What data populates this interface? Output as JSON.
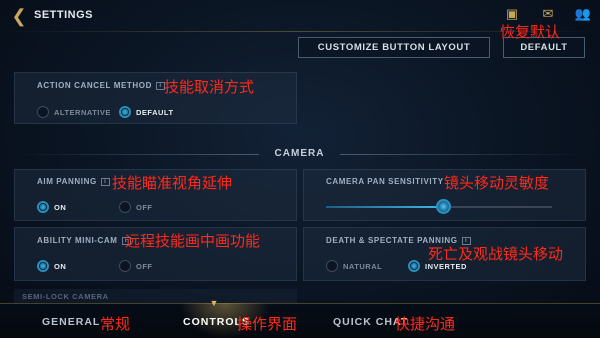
{
  "header": {
    "back_icon": "chevron-left-icon",
    "title": "SETTINGS",
    "icons": [
      "clipboard-check-icon",
      "chat-icon",
      "friends-icon"
    ]
  },
  "buttons": {
    "customize_layout": "CUSTOMIZE BUTTON LAYOUT",
    "default": "DEFAULT"
  },
  "general_settings": {
    "action_cancel_method": {
      "label": "ACTION CANCEL METHOD",
      "options": [
        "ALTERNATIVE",
        "DEFAULT"
      ],
      "selected": "DEFAULT"
    }
  },
  "camera": {
    "section_title": "CAMERA",
    "aim_panning": {
      "label": "AIM PANNING",
      "options": [
        "ON",
        "OFF"
      ],
      "selected": "ON"
    },
    "camera_pan_sensitivity": {
      "label": "CAMERA PAN SENSITIVITY",
      "value_fraction": 0.52
    },
    "ability_mini_cam": {
      "label": "ABILITY MINI-CAM",
      "options": [
        "ON",
        "OFF"
      ],
      "selected": "ON"
    },
    "death_spectate_panning": {
      "label": "DEATH & SPECTATE PANNING",
      "options": [
        "NATURAL",
        "INVERTED"
      ],
      "selected": "INVERTED"
    },
    "semi_lock_camera": {
      "label": "SEMI-LOCK CAMERA"
    }
  },
  "annotations": {
    "restore_default": "恢复默认",
    "action_cancel": "技能取消方式",
    "aim_panning": "技能瞄准视角延伸",
    "pan_sensitivity": "镜头移动灵敏度",
    "mini_cam": "远程技能画中画功能",
    "death_panning": "死亡及观战镜头移动",
    "general": "常规",
    "controls": "操作界面",
    "quick_chat": "快捷沟通"
  },
  "nav": {
    "tabs": [
      "GENERAL",
      "CONTROLS",
      "QUICK CHAT"
    ],
    "active": "CONTROLS"
  },
  "colors": {
    "accent_gold": "#c9a85a",
    "accent_blue": "#3fb6e8",
    "annotation_red": "#ff2a1a"
  }
}
